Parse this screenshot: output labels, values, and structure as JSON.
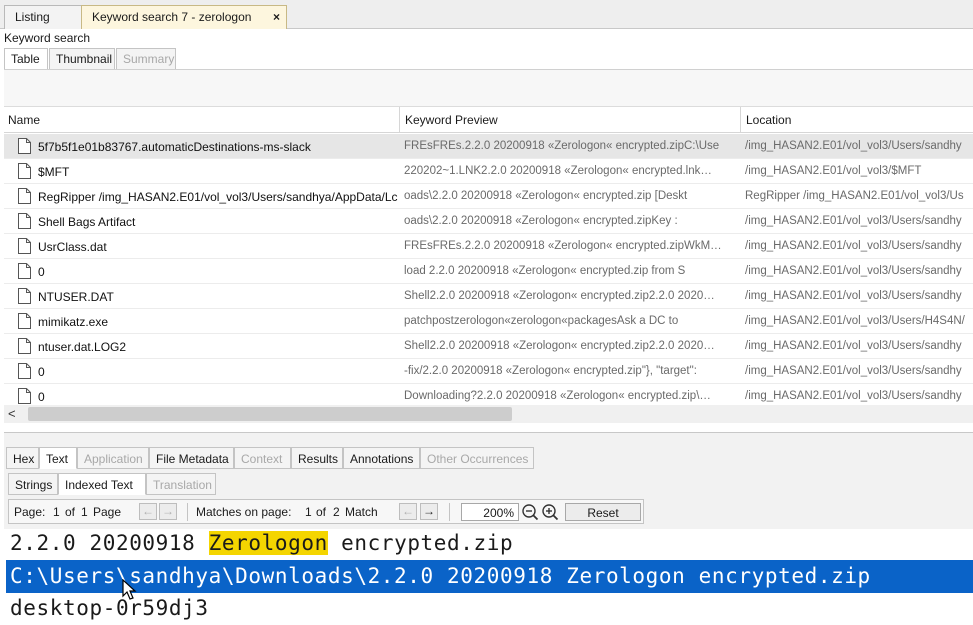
{
  "top_tabs": [
    {
      "label": "Listing",
      "active": false
    },
    {
      "label": "Keyword search 7 - zerologon",
      "active": true,
      "close": "×"
    }
  ],
  "section_label": "Keyword search",
  "view_tabs": [
    {
      "label": "Table",
      "active": true
    },
    {
      "label": "Thumbnail",
      "active": false
    },
    {
      "label": "Summary",
      "disabled": true
    }
  ],
  "table": {
    "columns": [
      "Name",
      "Keyword Preview",
      "Location"
    ],
    "rows": [
      {
        "name": "5f7b5f1e01b83767.automaticDestinations-ms-slack",
        "preview": "FREsFREs.2.2.0 20200918 «Zerologon« encrypted.zipC:\\Use",
        "location": "/img_HASAN2.E01/vol_vol3/Users/sandhy"
      },
      {
        "name": "$MFT",
        "preview": "220202~1.LNK2.2.0 20200918 «Zerologon« encrypted.lnk…",
        "location": "/img_HASAN2.E01/vol_vol3/$MFT"
      },
      {
        "name": "RegRipper /img_HASAN2.E01/vol_vol3/Users/sandhya/AppData/Lc",
        "preview": "oads\\2.2.0 20200918 «Zerologon« encrypted.zip [Deskt",
        "location": "RegRipper /img_HASAN2.E01/vol_vol3/Us"
      },
      {
        "name": "Shell Bags Artifact",
        "preview": "oads\\2.2.0 20200918 «Zerologon« encrypted.zipKey :",
        "location": "/img_HASAN2.E01/vol_vol3/Users/sandhy"
      },
      {
        "name": "UsrClass.dat",
        "preview": "FREsFREs.2.2.0 20200918 «Zerologon« encrypted.zipWkM…",
        "location": "/img_HASAN2.E01/vol_vol3/Users/sandhy"
      },
      {
        "name": "0",
        "preview": "load 2.2.0 20200918 «Zerologon« encrypted.zip from S",
        "location": "/img_HASAN2.E01/vol_vol3/Users/sandhy"
      },
      {
        "name": "NTUSER.DAT",
        "preview": "Shell2.2.0 20200918 «Zerologon« encrypted.zip2.2.0 2020…",
        "location": "/img_HASAN2.E01/vol_vol3/Users/sandhy"
      },
      {
        "name": "mimikatz.exe",
        "preview": "patchpostzerologon«zerologon«packagesAsk a DC to",
        "location": "/img_HASAN2.E01/vol_vol3/Users/H4S4N/"
      },
      {
        "name": "ntuser.dat.LOG2",
        "preview": "Shell2.2.0 20200918 «Zerologon« encrypted.zip2.2.0 2020…",
        "location": "/img_HASAN2.E01/vol_vol3/Users/sandhy"
      },
      {
        "name": "0",
        "preview": "-fix/2.2.0 20200918 «Zerologon« encrypted.zip\"}, \"target\":",
        "location": "/img_HASAN2.E01/vol_vol3/Users/sandhy"
      },
      {
        "name": "0",
        "preview": "Downloading?2.2.0 20200918 «Zerologon« encrypted.zip\\…",
        "location": "/img_HASAN2.E01/vol_vol3/Users/sandhy"
      }
    ],
    "scroll_left_arrow": "<"
  },
  "content_tabs": [
    {
      "label": "Hex",
      "disabled": false
    },
    {
      "label": "Text",
      "active": true
    },
    {
      "label": "Application",
      "disabled": true
    },
    {
      "label": "File Metadata",
      "disabled": false
    },
    {
      "label": "Context",
      "disabled": true
    },
    {
      "label": "Results",
      "disabled": false
    },
    {
      "label": "Annotations",
      "disabled": false
    },
    {
      "label": "Other Occurrences",
      "disabled": true
    }
  ],
  "text_tabs": [
    {
      "label": "Strings",
      "active": false
    },
    {
      "label": "Indexed Text",
      "active": true
    },
    {
      "label": "Translation",
      "disabled": true
    }
  ],
  "viewer": {
    "page_label": "Page:",
    "page_current": "1",
    "page_of": "of",
    "page_total": "1",
    "page_unit": "Page",
    "matches_label": "Matches on page:",
    "match_current": "1",
    "match_of": "of",
    "match_total": "2",
    "match_unit": "Match",
    "prev_arrow": "←",
    "next_arrow": "→",
    "zoom": "200%",
    "reset_label": "Reset"
  },
  "text_view": {
    "line1_pre": "2.2.0 20200918 ",
    "line1_highlight": "Zerologon",
    "line1_post": " encrypted.zip",
    "line2": "C:\\Users\\sandhya\\Downloads\\2.2.0 20200918 Zerologon encrypted.zip",
    "line3": "desktop-0r59dj3"
  },
  "colors": {
    "selection": "#0a63c8",
    "keyword_highlight": "#f4d500",
    "active_tab": "#fdf6de"
  }
}
